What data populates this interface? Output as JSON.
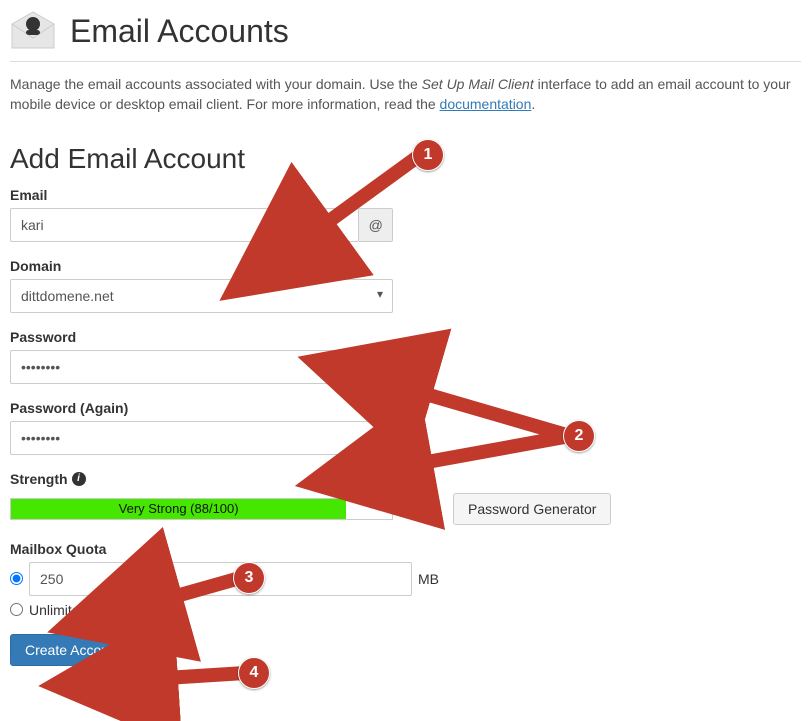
{
  "header": {
    "title": "Email Accounts"
  },
  "intro": {
    "prefix": "Manage the email accounts associated with your domain. Use the ",
    "em": "Set Up Mail Client",
    "middle": " interface to add an email account to your mobile device or desktop email client. For more information, read the ",
    "link": "documentation",
    "suffix": "."
  },
  "section_title": "Add Email Account",
  "labels": {
    "email": "Email",
    "domain": "Domain",
    "password": "Password",
    "password_again": "Password (Again)",
    "strength": "Strength",
    "quota": "Mailbox Quota",
    "unlimited": "Unlimited",
    "mb": "MB"
  },
  "values": {
    "email": "kari",
    "domain": "dittdomene.net",
    "password": "••••••••",
    "password2": "••••••••",
    "quota": "250"
  },
  "addon_at": "@",
  "strength": {
    "text": "Very Strong (88/100)",
    "percent": 88
  },
  "buttons": {
    "pwgen": "Password Generator",
    "create": "Create Account"
  },
  "callouts": {
    "c1": "1",
    "c2": "2",
    "c3": "3",
    "c4": "4"
  }
}
